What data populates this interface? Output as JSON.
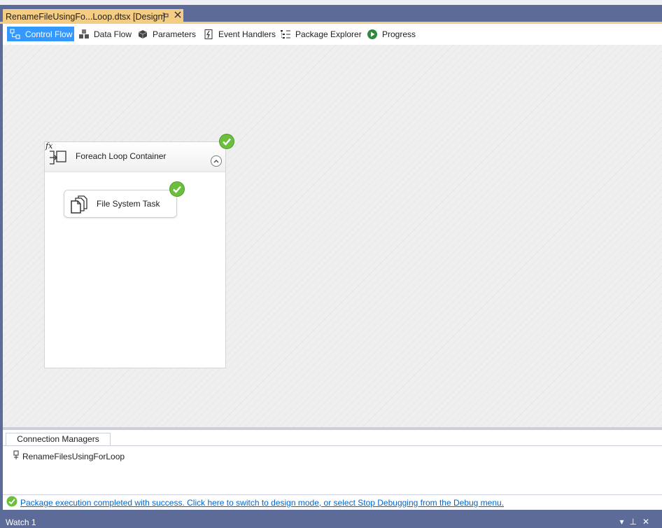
{
  "document_tab": {
    "title": "RenameFileUsingFo...Loop.dtsx [Design]",
    "pin_icon": "pin-icon",
    "close_icon": "close-icon"
  },
  "toolbar": {
    "items": [
      {
        "label": "Control Flow",
        "icon": "control-flow-icon",
        "active": true
      },
      {
        "label": "Data Flow",
        "icon": "data-flow-icon",
        "active": false
      },
      {
        "label": "Parameters",
        "icon": "parameters-icon",
        "active": false
      },
      {
        "label": "Event Handlers",
        "icon": "event-handlers-icon",
        "active": false
      },
      {
        "label": "Package Explorer",
        "icon": "package-explorer-icon",
        "active": false
      },
      {
        "label": "Progress",
        "icon": "progress-icon",
        "active": false
      }
    ]
  },
  "canvas": {
    "container": {
      "title": "Foreach Loop Container",
      "expression_marker": "fx",
      "status": "success",
      "task": {
        "title": "File System Task",
        "status": "success"
      }
    }
  },
  "connection_managers": {
    "tab_label": "Connection Managers",
    "items": [
      {
        "label": "RenameFilesUsingForLoop",
        "icon": "file-connection-icon"
      }
    ]
  },
  "status": {
    "message": "Package execution completed with success. Click here to switch to design mode, or select Stop Debugging from the Debug menu.",
    "icon": "success-check-icon"
  },
  "watch_panel": {
    "title": "Watch 1",
    "controls": [
      "dropdown-icon",
      "pin-icon",
      "close-icon"
    ]
  },
  "colors": {
    "accent": "#3399ff",
    "chrome": "#5d6b99",
    "document_tab": "#f5cc84",
    "success": "#6cbf3c",
    "link": "#0066cc"
  }
}
